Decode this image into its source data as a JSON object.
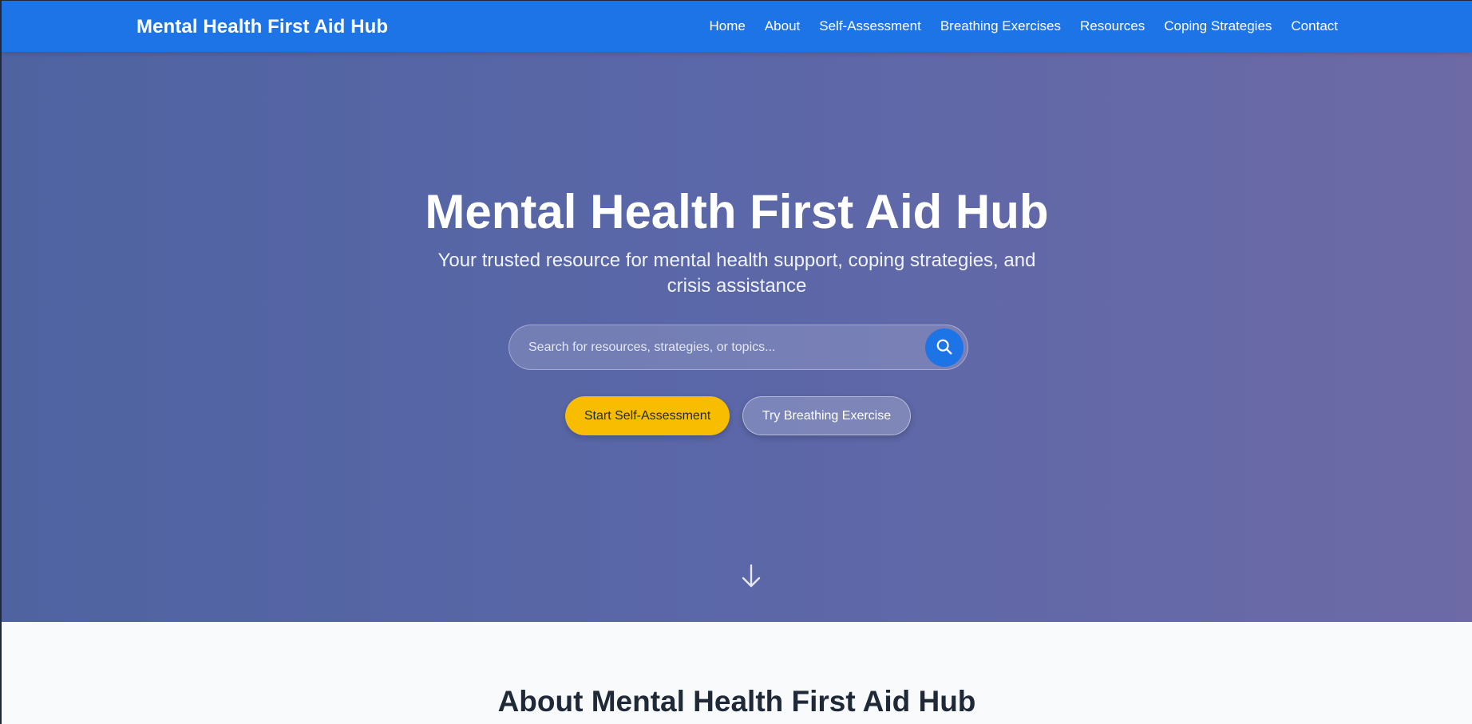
{
  "navbar": {
    "brand": "Mental Health First Aid Hub",
    "links": [
      "Home",
      "About",
      "Self-Assessment",
      "Breathing Exercises",
      "Resources",
      "Coping Strategies",
      "Contact"
    ]
  },
  "hero": {
    "title": "Mental Health First Aid Hub",
    "subtitle": "Your trusted resource for mental health support, coping strategies, and crisis assistance",
    "search": {
      "placeholder": "Search for resources, strategies, or topics...",
      "icon": "search-icon"
    },
    "primary_button": "Start Self-Assessment",
    "secondary_button": "Try Breathing Exercise",
    "scroll_icon": "arrow-down-icon"
  },
  "about": {
    "title": "About Mental Health First Aid Hub"
  },
  "colors": {
    "nav": "#1d74e6",
    "accent": "#f8bd00",
    "hero_start": "#4f63a1",
    "hero_end": "#6d6aa6"
  }
}
